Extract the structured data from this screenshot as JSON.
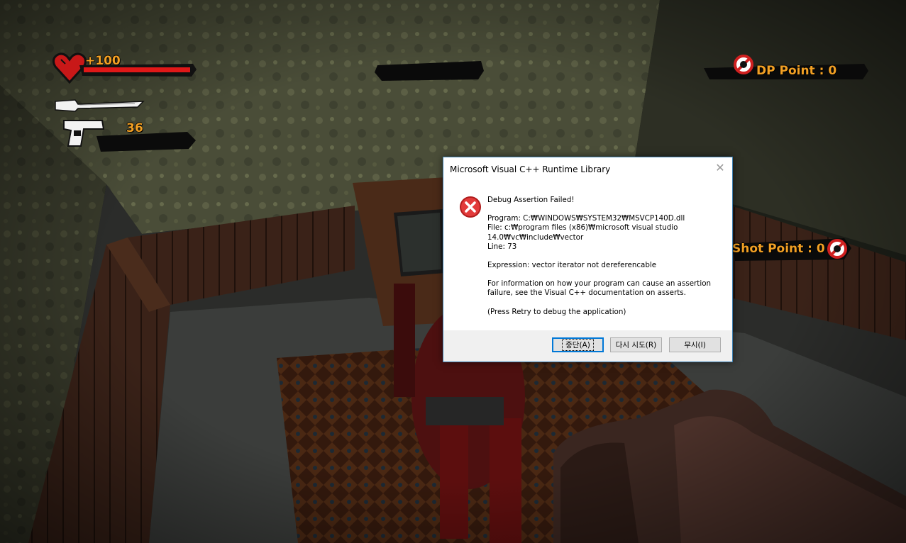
{
  "hud": {
    "health_value": "+100",
    "health_fraction": 1.0,
    "ammo_count": "36",
    "dp_point": "DP Point : 0",
    "shot_point": "Shot Point : 0",
    "accent_color": "#f2a024",
    "health_bar_color": "#e01818",
    "icons": [
      "heart-icon",
      "knife-icon",
      "pistol-icon",
      "no-entry-icon"
    ]
  },
  "dialog": {
    "title": "Microsoft Visual C++ Runtime Library",
    "close_glyph": "✕",
    "icon": "error-icon",
    "heading": "Debug Assertion Failed!",
    "program": "Program: C:₩WINDOWS₩SYSTEM32₩MSVCP140D.dll",
    "file_line1": "File: c:₩program files (x86)₩microsoft visual studio",
    "file_line2": "14.0₩vc₩include₩vector",
    "line": "Line: 73",
    "expression": "Expression: vector iterator not dereferencable",
    "info_line1": "For information on how your program can cause an assertion",
    "info_line2": "failure, see the Visual C++ documentation on asserts.",
    "retry_hint": "(Press Retry to debug the application)",
    "buttons": {
      "abort": "중단(A)",
      "retry": "다시 시도(R)",
      "ignore": "무시(I)"
    }
  }
}
